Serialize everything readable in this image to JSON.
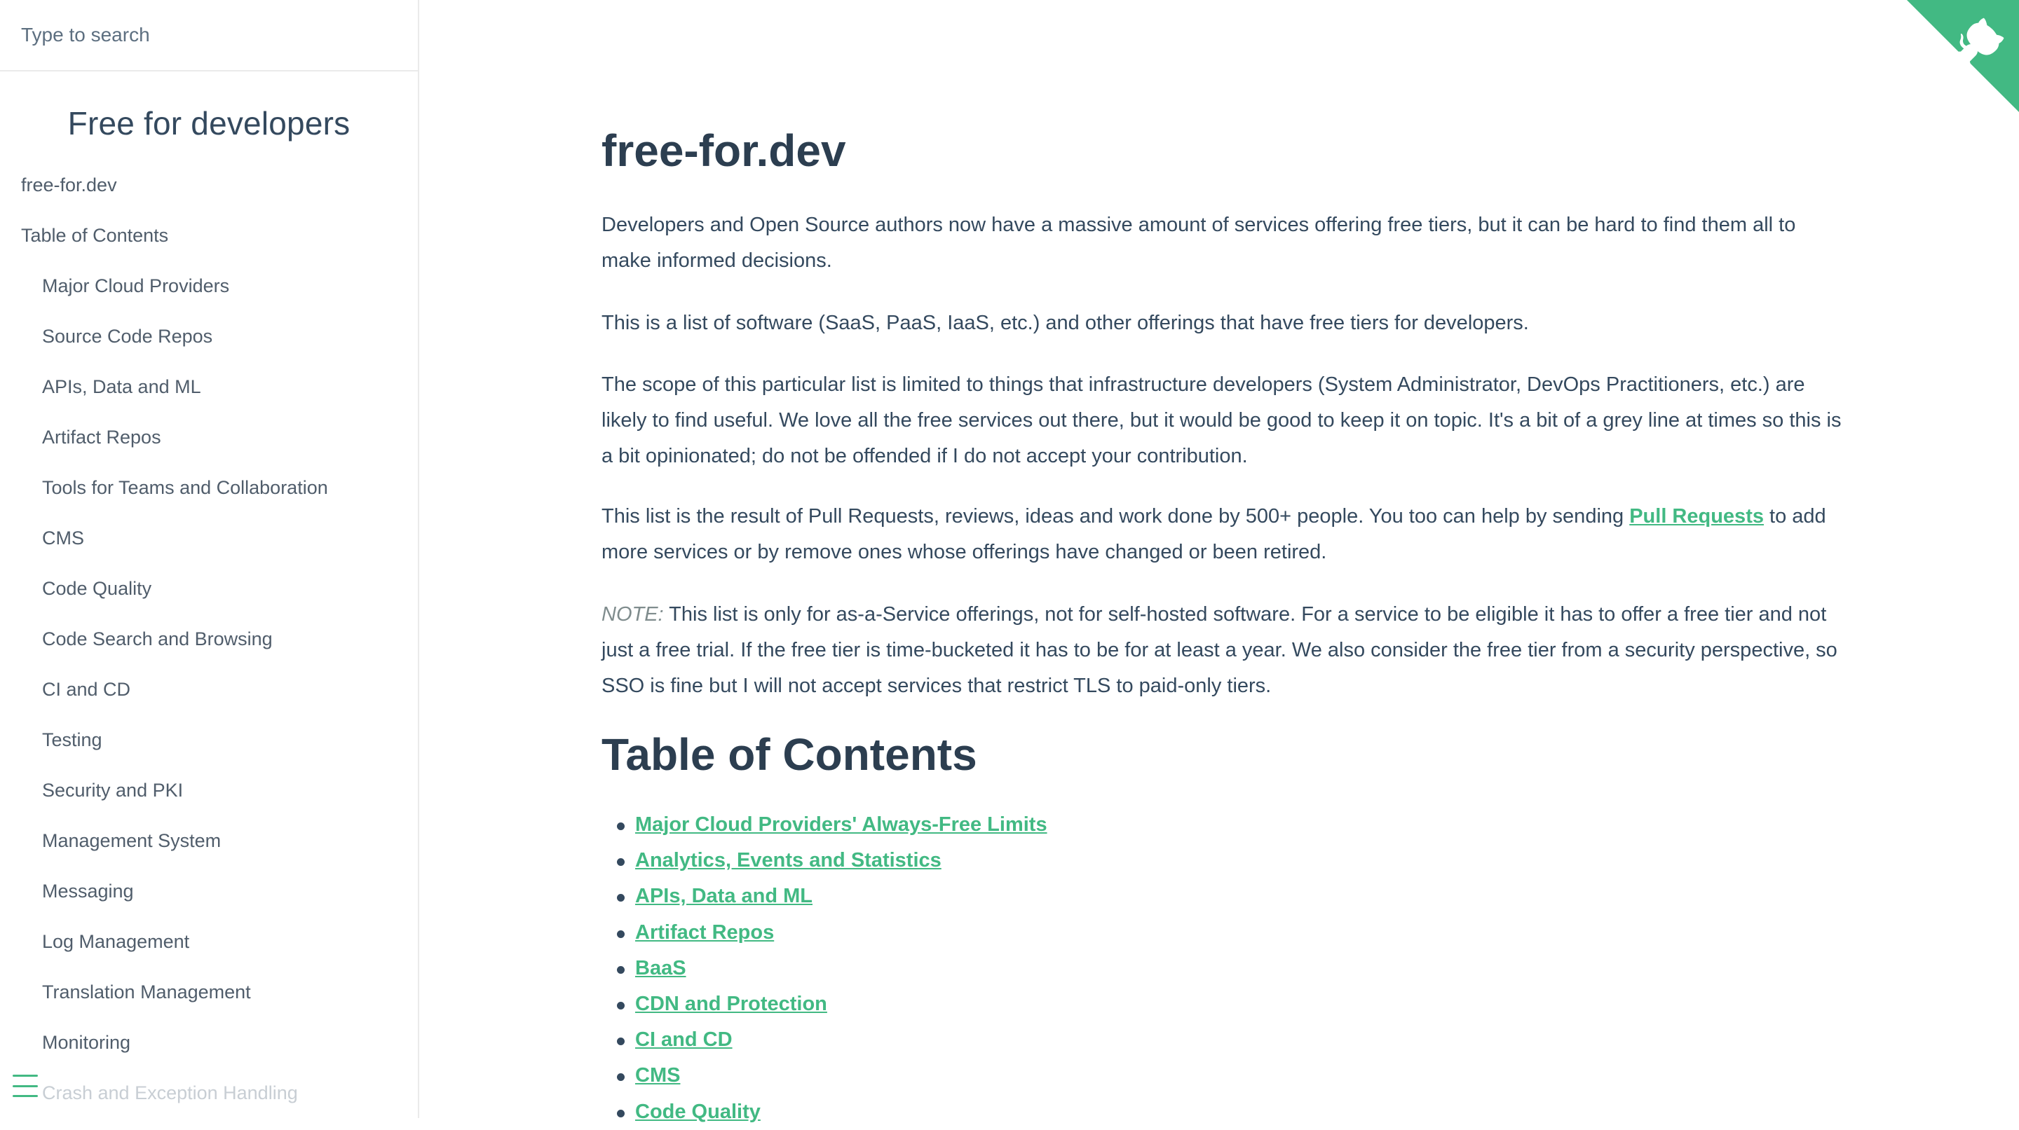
{
  "search": {
    "placeholder": "Type to search"
  },
  "sidebar": {
    "app_name": "Free for developers",
    "items": [
      {
        "label": "free-for.dev"
      },
      {
        "label": "Table of Contents"
      },
      {
        "label": "Major Cloud Providers"
      },
      {
        "label": "Source Code Repos"
      },
      {
        "label": "APIs, Data and ML"
      },
      {
        "label": "Artifact Repos"
      },
      {
        "label": "Tools for Teams and Collaboration"
      },
      {
        "label": "CMS"
      },
      {
        "label": "Code Quality"
      },
      {
        "label": "Code Search and Browsing"
      },
      {
        "label": "CI and CD"
      },
      {
        "label": "Testing"
      },
      {
        "label": "Security and PKI"
      },
      {
        "label": "Management System"
      },
      {
        "label": "Messaging"
      },
      {
        "label": "Log Management"
      },
      {
        "label": "Translation Management"
      },
      {
        "label": "Monitoring"
      },
      {
        "label": "Crash and Exception Handling"
      }
    ],
    "menu_icon": "hamburger-menu-icon"
  },
  "main": {
    "title": "free-for.dev",
    "p1": "Developers and Open Source authors now have a massive amount of services offering free tiers, but it can be hard to find them all to make informed decisions.",
    "p2": "This is a list of software (SaaS, PaaS, IaaS, etc.) and other offerings that have free tiers for developers.",
    "p3": "The scope of this particular list is limited to things that infrastructure developers (System Administrator, DevOps Practitioners, etc.) are likely to find useful. We love all the free services out there, but it would be good to keep it on topic. It's a bit of a grey line at times so this is a bit opinionated; do not be offended if I do not accept your contribution.",
    "p4_before": "This list is the result of Pull Requests, reviews, ideas and work done by 500+ people. You too can help by sending ",
    "p4_link": "Pull Requests",
    "p4_after": " to add more services or by remove ones whose offerings have changed or been retired.",
    "note_label": "NOTE:",
    "note_text": " This list is only for as-a-Service offerings, not for self-hosted software. For a service to be eligible it has to offer a free tier and not just a free trial. If the free tier is time-bucketed it has to be for at least a year. We also consider the free tier from a security perspective, so SSO is fine but I will not accept services that restrict TLS to paid-only tiers.",
    "toc_title": "Table of Contents",
    "toc": [
      {
        "label": "Major Cloud Providers' Always-Free Limits"
      },
      {
        "label": "Analytics, Events and Statistics"
      },
      {
        "label": "APIs, Data and ML"
      },
      {
        "label": "Artifact Repos"
      },
      {
        "label": "BaaS"
      },
      {
        "label": "CDN and Protection"
      },
      {
        "label": "CI and CD"
      },
      {
        "label": "CMS"
      },
      {
        "label": "Code Quality"
      }
    ]
  },
  "corner": {
    "icon": "github-octocat-icon",
    "color": "#42b983"
  },
  "colors": {
    "accent": "#42b983",
    "text": "#34495e",
    "heading": "#2c3e50"
  }
}
